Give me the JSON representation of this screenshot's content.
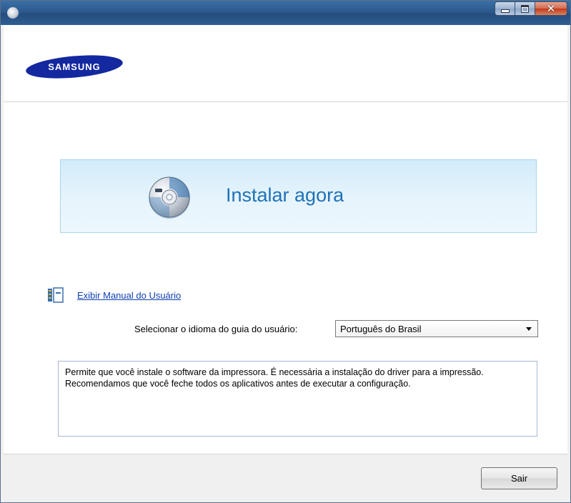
{
  "window": {
    "title": "",
    "controls": {
      "minimize": "minimize",
      "maximize": "maximize",
      "close": "close"
    }
  },
  "header": {
    "logo_text": "SAMSUNG"
  },
  "install": {
    "label": "Instalar agora",
    "icon": "cd-disc-icon"
  },
  "manual": {
    "link_text": "Exibir Manual do Usuário",
    "icon": "manual-book-icon"
  },
  "language": {
    "label": "Selecionar o idioma do guia do usuário:",
    "selected": "Português do Brasil"
  },
  "description": {
    "line1": "Permite que você instale o software da impressora. É necessária a instalação do driver para a impressão.",
    "line2": "Recomendamos que você feche todos os aplicativos antes de executar a configuração."
  },
  "footer": {
    "exit_label": "Sair"
  },
  "colors": {
    "titlebar": "#2c5a8e",
    "install_text": "#1f72b8",
    "link": "#0d3fb3",
    "logo_blue": "#1428a0"
  }
}
